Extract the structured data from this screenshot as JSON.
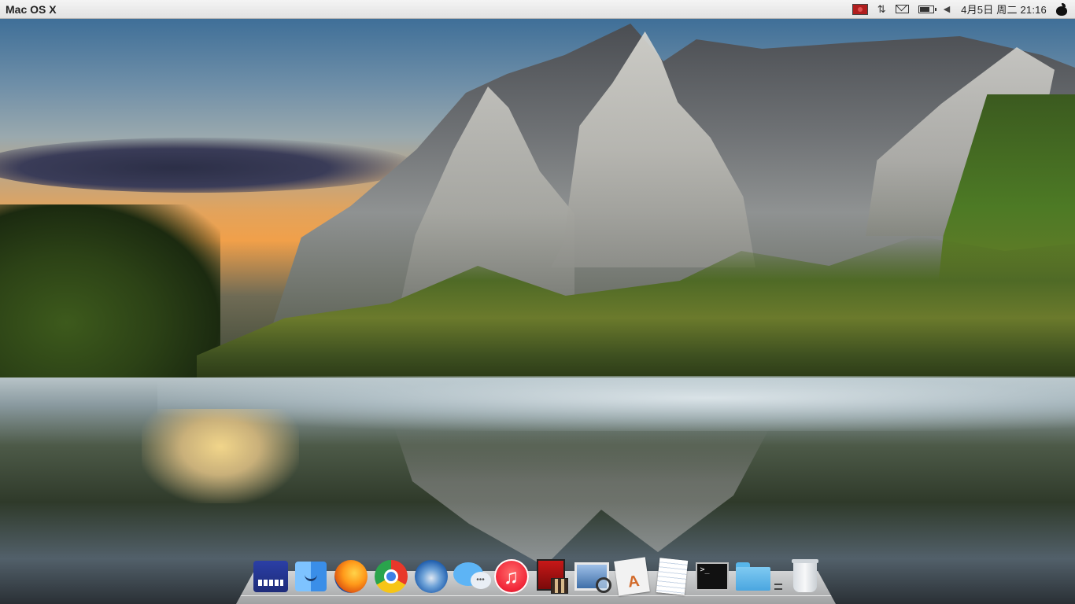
{
  "menubar": {
    "app_title": "Mac OS X",
    "clock": "4月5日 周二 21:16",
    "tray_icons": [
      "input-method-flag-icon",
      "network-arrows-icon",
      "mail-icon",
      "battery-icon",
      "volume-icon",
      "apple-icon"
    ]
  },
  "dock": {
    "items": [
      {
        "name": "sound-settings-icon"
      },
      {
        "name": "finder-icon"
      },
      {
        "name": "firefox-icon"
      },
      {
        "name": "chrome-icon"
      },
      {
        "name": "thunderbird-icon"
      },
      {
        "name": "messages-icon"
      },
      {
        "name": "itunes-icon",
        "glyph": "♫"
      },
      {
        "name": "movie-icon"
      },
      {
        "name": "preview-icon"
      },
      {
        "name": "app-store-icon"
      },
      {
        "name": "textedit-icon"
      },
      {
        "name": "terminal-icon",
        "glyph": ">_"
      },
      {
        "name": "folder-icon"
      },
      {
        "name": "trash-icon"
      }
    ]
  },
  "colors": {
    "menubar_top": "#f4f4f4",
    "menubar_bottom": "#e2e2e2",
    "itunes_red": "#f2283a",
    "folder_blue": "#4aa6e0"
  }
}
